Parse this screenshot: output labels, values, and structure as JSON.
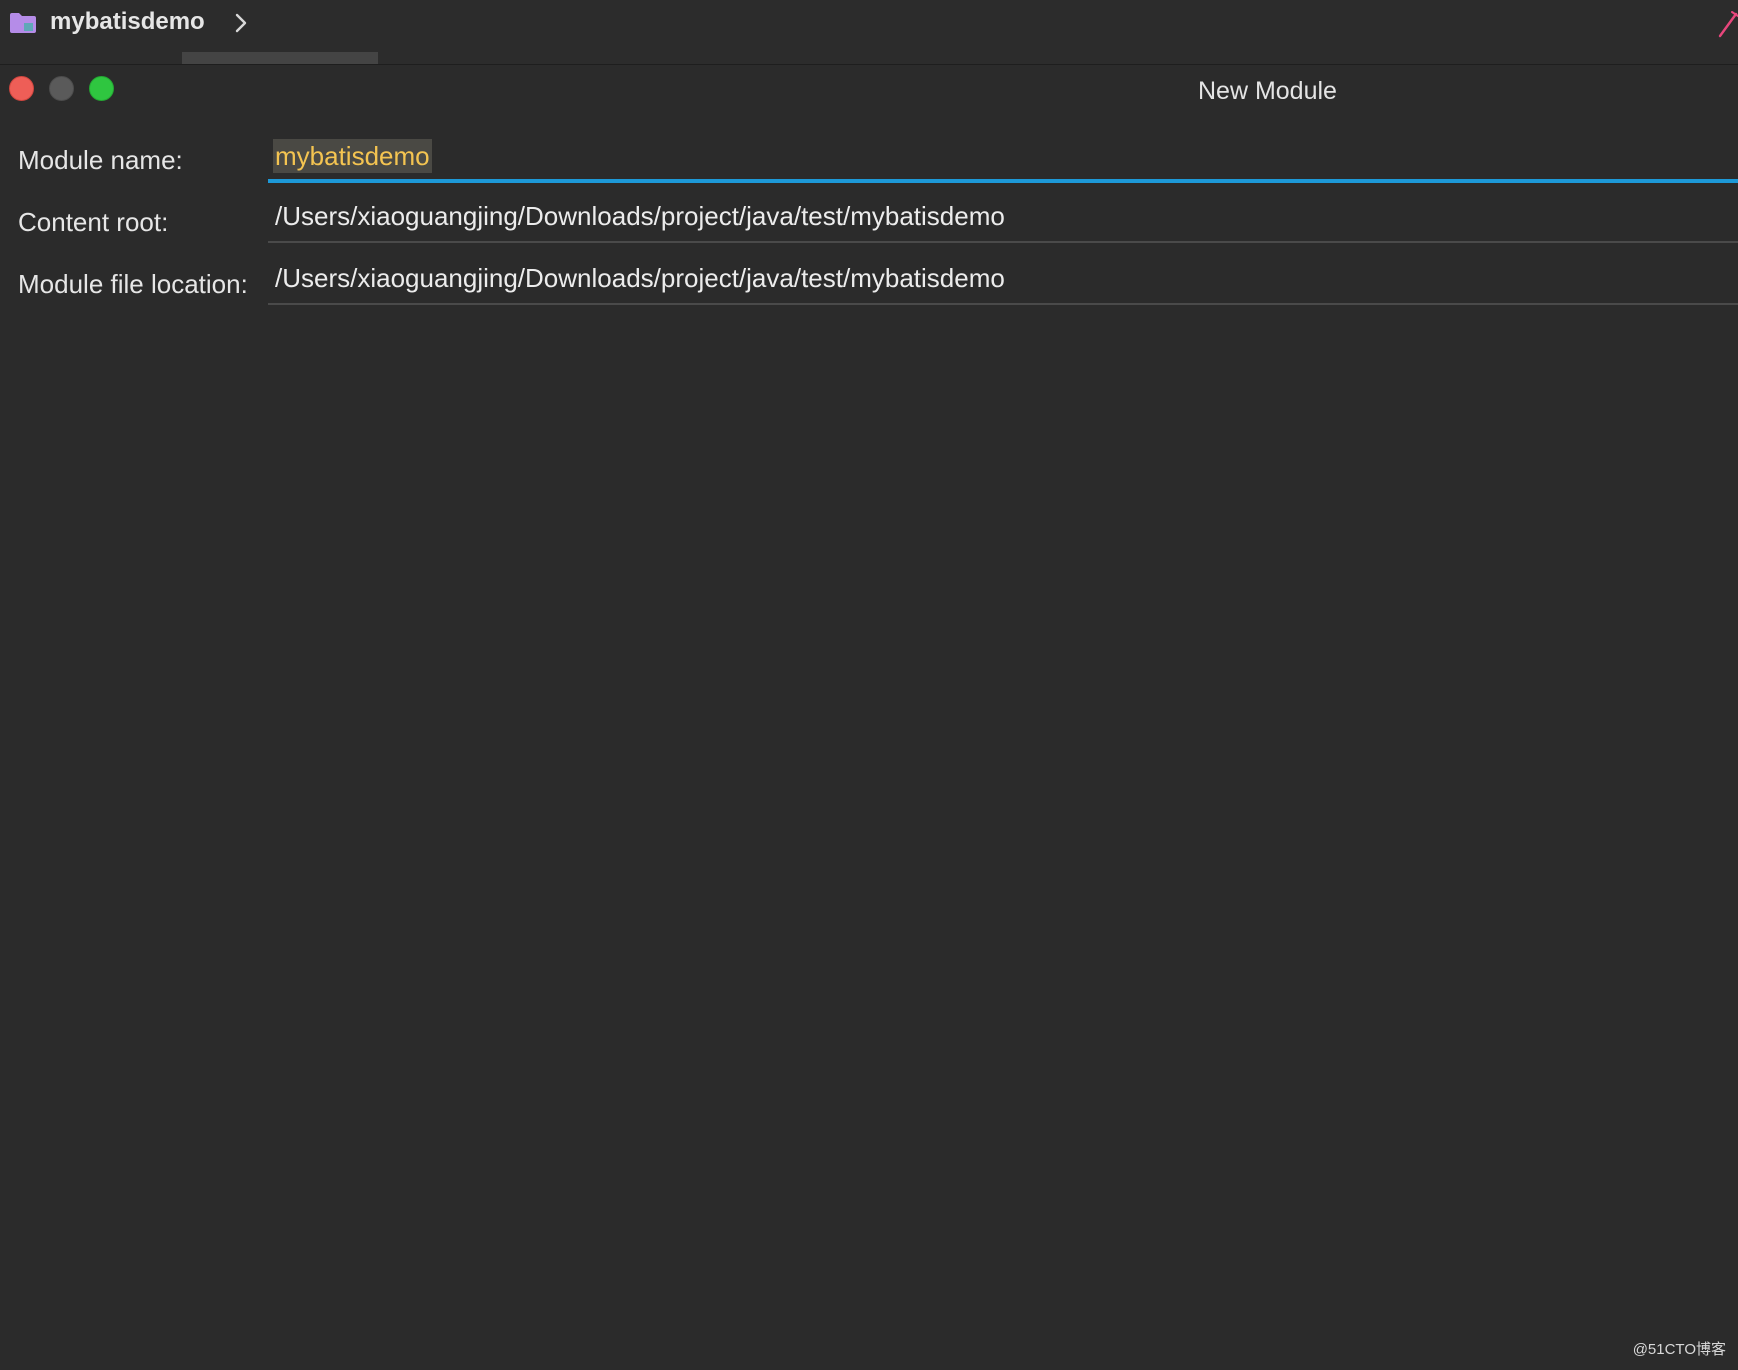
{
  "nav": {
    "breadcrumb_label": "mybatisdemo",
    "folder_icon": "folder-icon",
    "chevron_icon": "chevron-right-icon",
    "folder_color": "#b58ce8",
    "corner_icon_color": "#e8467c"
  },
  "window": {
    "title": "New Module",
    "traffic_lights": {
      "close_color": "#ee5e57",
      "minimize_color": "#5a5a5a",
      "maximize_color": "#2fc640"
    }
  },
  "form": {
    "module_name": {
      "label": "Module name:",
      "value": "mybatisdemo"
    },
    "content_root": {
      "label": "Content root:",
      "value": "/Users/xiaoguangjing/Downloads/project/java/test/mybatisdemo"
    },
    "module_file_location": {
      "label": "Module file location:",
      "value": "/Users/xiaoguangjing/Downloads/project/java/test/mybatisdemo"
    }
  },
  "colors": {
    "background": "#2b2b2b",
    "focus_accent": "#1d99d8",
    "selection_text": "#f4c451"
  },
  "watermark": "@51CTO博客"
}
